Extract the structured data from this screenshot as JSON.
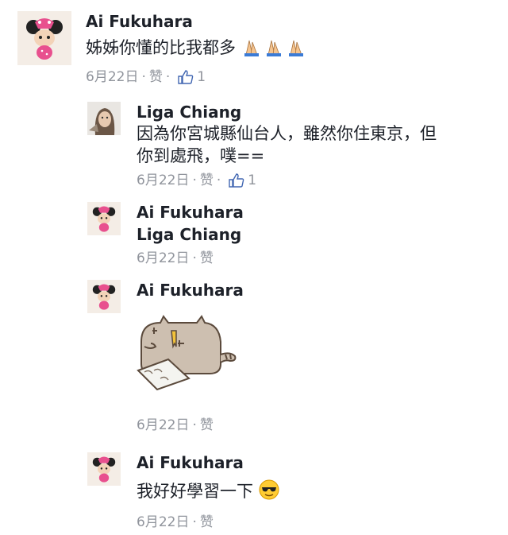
{
  "comments": [
    {
      "author": "Ai Fukuhara",
      "text": "姊姊你懂的比我都多",
      "text_emoji": "folded-hands-icon ×3",
      "date": "6月22日",
      "like_label": "赞",
      "like_count": "1"
    },
    {
      "author": "Liga Chiang",
      "text_line1": "因為你宮城縣仙台人，雖然你住東京，但",
      "text_line2": "你到處飛，噗==",
      "date": "6月22日",
      "like_label": "赞",
      "like_count": "1"
    },
    {
      "author": "Ai Fukuhara",
      "text": "Liga Chiang",
      "date": "6月22日",
      "like_label": "赞"
    },
    {
      "author": "Ai Fukuhara",
      "sticker": "pusheen-writing-sticker",
      "date": "6月22日",
      "like_label": "赞"
    },
    {
      "author": "Ai Fukuhara",
      "text": "我好好學習一下",
      "text_emoji": "cool-sunglasses-emoji",
      "date": "6月22日",
      "like_label": "赞"
    }
  ],
  "colors": {
    "name": "#1d2129",
    "meta": "#90949c",
    "like_blue": "#4267b2"
  }
}
